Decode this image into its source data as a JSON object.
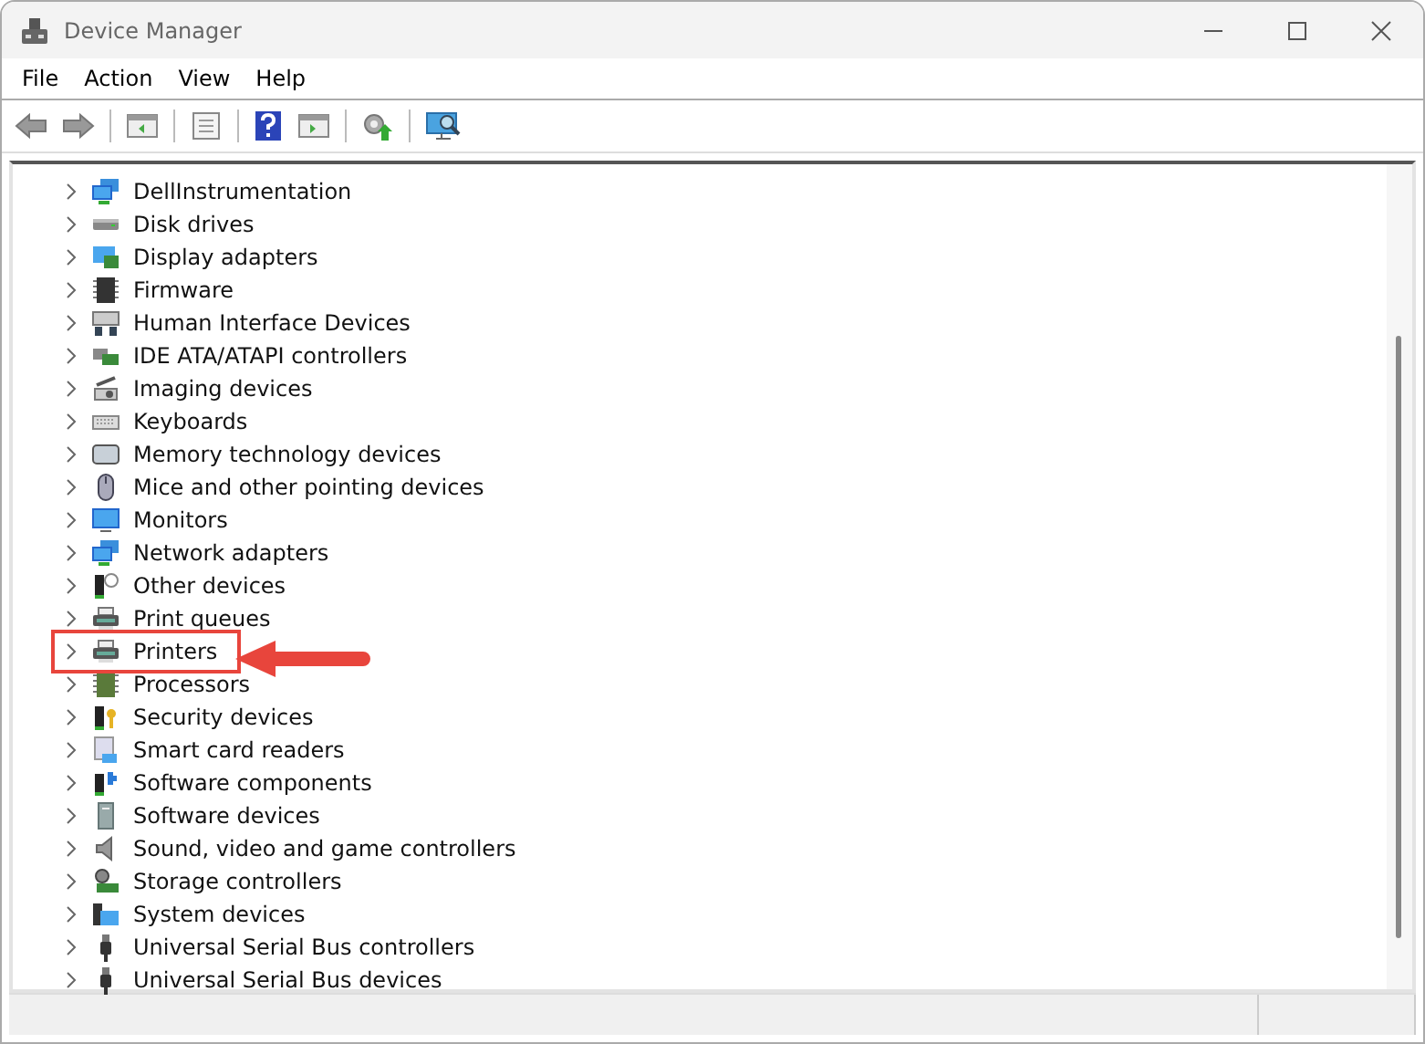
{
  "window": {
    "title": "Device Manager"
  },
  "menu": [
    "File",
    "Action",
    "View",
    "Help"
  ],
  "tree": {
    "items": [
      {
        "label": "DellInstrumentation",
        "expanded": false
      },
      {
        "label": "Disk drives",
        "expanded": false
      },
      {
        "label": "Display adapters",
        "expanded": false
      },
      {
        "label": "Firmware",
        "expanded": false
      },
      {
        "label": "Human Interface Devices",
        "expanded": false
      },
      {
        "label": "IDE ATA/ATAPI controllers",
        "expanded": false
      },
      {
        "label": "Imaging devices",
        "expanded": false
      },
      {
        "label": "Keyboards",
        "expanded": false
      },
      {
        "label": "Memory technology devices",
        "expanded": false
      },
      {
        "label": "Mice and other pointing devices",
        "expanded": false
      },
      {
        "label": "Monitors",
        "expanded": false
      },
      {
        "label": "Network adapters",
        "expanded": false
      },
      {
        "label": "Other devices",
        "expanded": false
      },
      {
        "label": "Print queues",
        "expanded": false
      },
      {
        "label": "Printers",
        "expanded": false,
        "highlighted": true
      },
      {
        "label": "Processors",
        "expanded": false
      },
      {
        "label": "Security devices",
        "expanded": false
      },
      {
        "label": "Smart card readers",
        "expanded": false
      },
      {
        "label": "Software components",
        "expanded": false
      },
      {
        "label": "Software devices",
        "expanded": false
      },
      {
        "label": "Sound, video and game controllers",
        "expanded": false
      },
      {
        "label": "Storage controllers",
        "expanded": false
      },
      {
        "label": "System devices",
        "expanded": false
      },
      {
        "label": "Universal Serial Bus controllers",
        "expanded": false
      },
      {
        "label": "Universal Serial Bus devices",
        "expanded": false
      }
    ]
  }
}
